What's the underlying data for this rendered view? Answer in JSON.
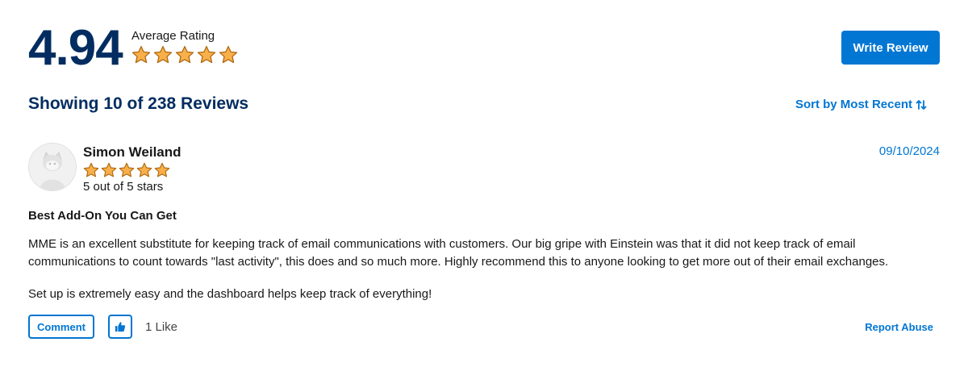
{
  "summary": {
    "average_rating": "4.94",
    "average_label": "Average Rating",
    "stars": 5
  },
  "actions": {
    "write_review_label": "Write Review",
    "sort_label": "Sort by Most Recent"
  },
  "list": {
    "showing_text": "Showing 10 of 238 Reviews"
  },
  "review": {
    "reviewer_name": "Simon Weiland",
    "stars": 5,
    "stars_text": "5 out of 5 stars",
    "date": "09/10/2024",
    "title": "Best Add-On You Can Get",
    "body_paragraphs": [
      "MME is an excellent substitute for keeping track of email communications with customers. Our big gripe with Einstein was that it did not keep track of email communications to count towards \"last activity\", this does and so much more. Highly recommend this to anyone looking to get more out of their email exchanges.",
      "Set up is extremely easy and the dashboard helps keep track of everything!"
    ],
    "comment_label": "Comment",
    "like_count_text": "1 Like",
    "report_label": "Report Abuse"
  },
  "colors": {
    "navy": "#032d60",
    "brand_blue": "#0176d3",
    "star_fill": "#f9b04b",
    "star_stroke": "#b06a12"
  },
  "icons": {
    "star": "star-icon",
    "sort": "sort-arrows-icon",
    "like": "thumbs-up-icon",
    "avatar": "default-avatar-icon"
  }
}
